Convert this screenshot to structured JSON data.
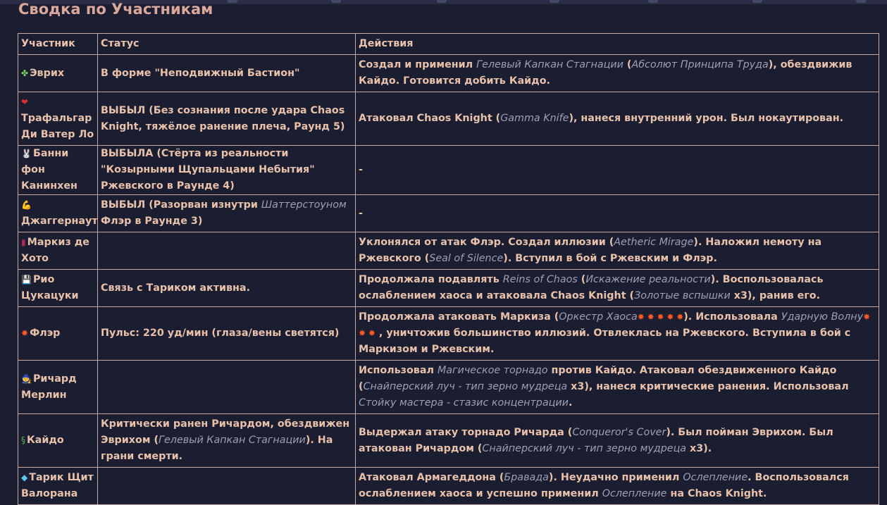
{
  "page": {
    "title": "Сводка по Участникам"
  },
  "table": {
    "headers": [
      "Участник",
      "Статус",
      "Действия"
    ],
    "rows": [
      {
        "icon": "✤",
        "icon_name": "clover-icon",
        "icon_color": "#7fd35a",
        "name": "Эврих",
        "status": [
          {
            "t": "В форме \"Неподвижный Бастион\""
          }
        ],
        "actions": [
          {
            "t": "Создал и применил "
          },
          {
            "t": "Гелевый Капкан Стагнации",
            "i": true
          },
          {
            "t": " ("
          },
          {
            "t": "Абсолют Принципа Труда",
            "i": true
          },
          {
            "t": "), обездвижив Кайдо. Готовится добить Кайдо."
          }
        ]
      },
      {
        "icon": "❤",
        "icon_name": "heart-icon",
        "icon_color": "#e0302e",
        "name": "Трафальгар Ди Ватер Ло",
        "status": [
          {
            "t": "ВЫБЫЛ"
          },
          {
            "t": " (Без сознания после удара Chaos Knight, тяжёлое ранение плеча, Раунд 5)"
          }
        ],
        "actions": [
          {
            "t": "Атаковал Chaos Knight ("
          },
          {
            "t": "Gamma Knife",
            "i": true
          },
          {
            "t": "), нанеся внутренний урон. Был нокаутирован."
          }
        ]
      },
      {
        "icon": "🐰",
        "icon_name": "rabbit-icon",
        "icon_color": "#d8d8e0",
        "name": "Банни фон Канинхен",
        "status": [
          {
            "t": "ВЫБЫЛА"
          },
          {
            "t": " (Стёрта из реальности \"Козырными Щупальцами Небытия\" Ржевского в Раунде 4)"
          }
        ],
        "actions": [
          {
            "t": "-"
          }
        ]
      },
      {
        "icon": "💪",
        "icon_name": "flexed-biceps-icon",
        "icon_color": "#f2b21f",
        "name": "Джаггернаут",
        "status": [
          {
            "t": "ВЫБЫЛ"
          },
          {
            "t": " (Разорван изнутри "
          },
          {
            "t": "Шаттерстоуном",
            "i": true
          },
          {
            "t": " Флэр в Раунде 3)"
          }
        ],
        "actions": [
          {
            "t": "-"
          }
        ]
      },
      {
        "icon": "▮",
        "icon_name": "top-hat-icon",
        "icon_color": "#b4275a",
        "name": "Маркиз де Хото",
        "status": [],
        "actions": [
          {
            "t": "Уклонялся от атак Флэр. Создал иллюзии ("
          },
          {
            "t": "Aetheric Mirage",
            "i": true
          },
          {
            "t": "). Наложил немоту на Ржевского ("
          },
          {
            "t": "Seal of Silence",
            "i": true
          },
          {
            "t": "). Вступил в бой с Ржевским и Флэр."
          }
        ]
      },
      {
        "icon": "💾",
        "icon_name": "floppy-disk-icon",
        "icon_color": "#cfd5ec",
        "name": "Рио Цукацуки",
        "status": [
          {
            "t": "Связь с Тариком активна."
          }
        ],
        "actions": [
          {
            "t": "Продолжала подавлять "
          },
          {
            "t": "Reins of Chaos",
            "i": true
          },
          {
            "t": " ("
          },
          {
            "t": "Искажение реальности",
            "i": true
          },
          {
            "t": "). Воспользовалась ослаблением хаоса и атаковала Chaos Knight ("
          },
          {
            "t": "Золотые вспышки",
            "i": true
          },
          {
            "t": " x3), ранив его."
          }
        ]
      },
      {
        "icon": "✸",
        "icon_name": "collision-icon",
        "icon_color": "#ff5a22",
        "name": "Флэр",
        "status": [
          {
            "t": "Пульс: 220 уд/мин (глаза/вены светятся)"
          }
        ],
        "actions": [
          {
            "t": "Продолжала атаковать Маркиза ("
          },
          {
            "t": "Оркестр Хаоса",
            "i": true
          },
          {
            "t": "✸ ✸ ✸ ✸ ✸",
            "c": "#ff5a22"
          },
          {
            "t": "). Использовала "
          },
          {
            "t": "Ударную Волну",
            "i": true
          },
          {
            "t": "✸ ✸ ✸",
            "c": "#ff5a22"
          },
          {
            "t": " , уничтожив большинство иллюзий. Отвлеклась на Ржевского. Вступила в бой с Маркизом и Ржевским."
          }
        ]
      },
      {
        "icon": "🧙",
        "icon_name": "mage-icon",
        "icon_color": "#4fa8e8",
        "name": "Ричард Мерлин",
        "status": [],
        "actions": [
          {
            "t": "Использовал "
          },
          {
            "t": "Магическое торнадо",
            "i": true
          },
          {
            "t": " против Кайдо. Атаковал обездвиженного Кайдо ("
          },
          {
            "t": "Снайперский луч - тип зерно мудреца",
            "i": true
          },
          {
            "t": " x3), нанеся критические ранения. Использовал "
          },
          {
            "t": "Стойку мастера - стазис концентрации",
            "i": true
          },
          {
            "t": "."
          }
        ]
      },
      {
        "icon": "§",
        "icon_name": "dragon-icon",
        "icon_color": "#4cc04a",
        "name": "Кайдо",
        "status": [
          {
            "t": "Критически ранен Ричардом, обездвижен Эврихом ("
          },
          {
            "t": "Гелевый Капкан Стагнации",
            "i": true
          },
          {
            "t": "). На грани смерти."
          }
        ],
        "actions": [
          {
            "t": "Выдержал атаку торнадо Ричарда ("
          },
          {
            "t": "Conqueror's Cover",
            "i": true
          },
          {
            "t": "). Был пойман Эврихом. Был атакован Ричардом ("
          },
          {
            "t": "Снайперский луч - тип зерно мудреца",
            "i": true
          },
          {
            "t": " x3)."
          }
        ]
      },
      {
        "icon": "◆",
        "icon_name": "gem-icon",
        "icon_color": "#5fc4f0",
        "name": "Тарик Щит Валорана",
        "status": [],
        "actions": [
          {
            "t": "Атаковал Армагеддона ("
          },
          {
            "t": "Бравада",
            "i": true
          },
          {
            "t": "). Неудачно применил "
          },
          {
            "t": "Ослепление",
            "i": true
          },
          {
            "t": ". Воспользовался ослаблением хаоса и успешно применил "
          },
          {
            "t": "Ослепление",
            "i": true
          },
          {
            "t": " на Chaos Knight."
          }
        ]
      }
    ]
  }
}
